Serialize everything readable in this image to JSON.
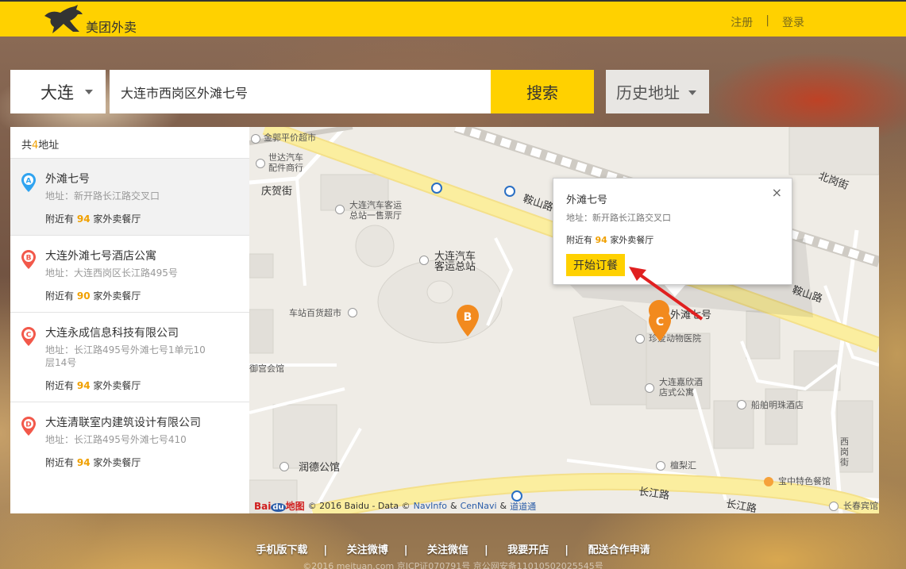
{
  "header": {
    "logo_text": "美团外卖",
    "register_label": "注册",
    "separator": "|",
    "login_label": "登录"
  },
  "search": {
    "city": "大连",
    "query": "大连市西岗区外滩七号",
    "search_label": "搜索",
    "history_label": "历史地址"
  },
  "list": {
    "count_prefix": "共",
    "count": "4",
    "count_suffix": "地址",
    "items": [
      {
        "letter": "A",
        "color": "#2fa3f0",
        "name": "外滩七号",
        "detail": "地址：新开路长江路交叉口",
        "near_prefix": "附近有",
        "near_count": "94",
        "near_suffix": "家外卖餐厅"
      },
      {
        "letter": "B",
        "color": "#f2584a",
        "name": "大连外滩七号酒店公寓",
        "detail": "地址：大连西岗区长江路495号",
        "near_prefix": "附近有",
        "near_count": "90",
        "near_suffix": "家外卖餐厅"
      },
      {
        "letter": "C",
        "color": "#f2584a",
        "name": "大连永成信息科技有限公司",
        "detail": "地址：长江路495号外滩七号1单元10层14号",
        "near_prefix": "附近有",
        "near_count": "94",
        "near_suffix": "家外卖餐厅"
      },
      {
        "letter": "D",
        "color": "#f2584a",
        "name": "大连清联室内建筑设计有限公司",
        "detail": "地址：长江路495号外滩七号410",
        "near_prefix": "附近有",
        "near_count": "94",
        "near_suffix": "家外卖餐厅"
      }
    ]
  },
  "map": {
    "labels": {
      "jinlang": "金郭平价超市",
      "shida": "世达汽车\n配件商行",
      "qinghe": "庆贺街",
      "dalianqiche": "大连汽车客运\n总站一售票厅",
      "kunshan1": "鞍山路",
      "kunshan2": "鞍山路",
      "beigang": "北岗街",
      "zongzhan": "大连汽车\n客运总站",
      "chezhan": "车站百货超市",
      "yuguan": "御宫会馆",
      "waitan": "外滩七号",
      "zhendong": "珍爱动物医院",
      "jiaxin": "大连嘉欣酒\n店式公寓",
      "chuanchuan": "船舶明珠酒店",
      "xigang": "西岗街",
      "runde": "润德公馆",
      "tanlihui": "檀梨汇",
      "baozhong": "宝中特色餐馆",
      "changjiang1": "长江路",
      "changjiang2": "长江路",
      "changchun": "长春宾馆"
    },
    "marker_b": "B",
    "marker_c": "C",
    "copyright": {
      "baidu_a": "Bai",
      "baidu_du": "du",
      "baidu_b": "地图",
      "text": "© 2016 Baidu - Data ©",
      "navinfo": "NavInfo",
      "amp1": "&",
      "cennavi": "CenNavi",
      "amp2": "&",
      "daodaotong": "道道通"
    }
  },
  "popup": {
    "name": "外滩七号",
    "address": "地址：新开路长江路交叉口",
    "near_prefix": "附近有",
    "near_count": "94",
    "near_suffix": "家外卖餐厅",
    "order_label": "开始订餐",
    "close_icon": "×"
  },
  "footer": {
    "links": [
      "手机版下载",
      "关注微博",
      "关注微信",
      "我要开店",
      "配送合作申请"
    ],
    "separator": "|",
    "copyright": "©2016 meituan.com 京ICP证070791号 京公网安备11010502025545号"
  },
  "colors": {
    "brand_yellow": "#ffd100",
    "highlight_orange": "#f0a000",
    "pin_blue": "#2fa3f0",
    "pin_red": "#f2584a",
    "marker_orange": "#f28a1e"
  }
}
